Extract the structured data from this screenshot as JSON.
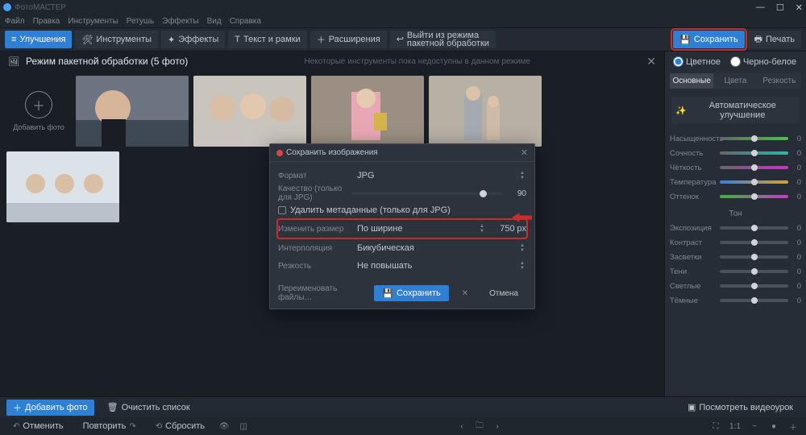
{
  "app": {
    "name": "ФотоМАСТЕР"
  },
  "menu": [
    "Файл",
    "Правка",
    "Инструменты",
    "Ретушь",
    "Эффекты",
    "Вид",
    "Справка"
  ],
  "toolbar": {
    "enhance": "Улучшения",
    "tools": "Инструменты",
    "effects": "Эффекты",
    "text": "Текст и рамки",
    "ext": "Расширения",
    "exit_batch_l1": "Выйти из режима",
    "exit_batch_l2": "пакетной обработки",
    "save": "Сохранить",
    "print": "Печать"
  },
  "header": {
    "title": "Режим пакетной обработки (5 фото)",
    "note": "Некоторые инструменты пока недоступны в данном режиме"
  },
  "add_tile": "Добавить фото",
  "side": {
    "radio_color": "Цветное",
    "radio_bw": "Черно-белое",
    "tabs": [
      "Основные",
      "Цвета",
      "Резкость"
    ],
    "auto": "Автоматическое улучшение",
    "sliders1": [
      {
        "label": "Насыщенность",
        "val": "0",
        "grad": "grad-sat"
      },
      {
        "label": "Сочность",
        "val": "0",
        "grad": "grad-vib"
      },
      {
        "label": "Чёткость",
        "val": "0",
        "grad": "grad-clar"
      },
      {
        "label": "Температура",
        "val": "0",
        "grad": "grad-temp"
      },
      {
        "label": "Оттенок",
        "val": "0",
        "grad": "grad-tint"
      }
    ],
    "section_tone": "Тон",
    "sliders2": [
      {
        "label": "Экспозиция",
        "val": "0"
      },
      {
        "label": "Контраст",
        "val": "0"
      },
      {
        "label": "Засветки",
        "val": "0"
      },
      {
        "label": "Тени",
        "val": "0"
      },
      {
        "label": "Светлые",
        "val": "0"
      },
      {
        "label": "Тёмные",
        "val": "0"
      }
    ]
  },
  "bottom": {
    "add": "Добавить фото",
    "clear": "Очистить список",
    "tutorial": "Посмотреть видеоурок",
    "undo": "Отменить",
    "redo": "Повторить",
    "reset": "Сбросить",
    "zoom": "1:1"
  },
  "dialog": {
    "title": "Сохранить изображения",
    "format_lbl": "Формат",
    "format_val": "JPG",
    "quality_lbl": "Качество (только для JPG)",
    "quality_val": "90",
    "strip_meta": "Удалить метаданные (только для JPG)",
    "resize_lbl": "Изменить размер",
    "resize_val": "По ширине",
    "resize_px": "750",
    "px_unit": "px",
    "interp_lbl": "Интерполяция",
    "interp_val": "Бикубическая",
    "sharp_lbl": "Резкость",
    "sharp_val": "Не повышать",
    "rename": "Переименовать файлы…",
    "save": "Сохранить",
    "cancel": "Отмена"
  }
}
